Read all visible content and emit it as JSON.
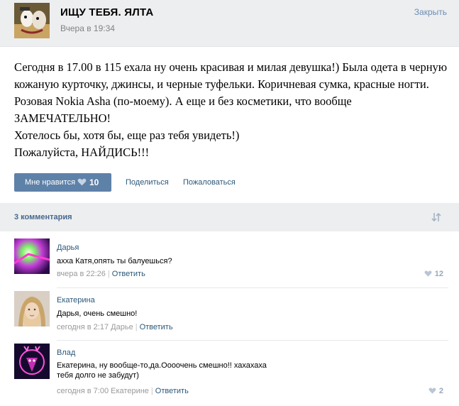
{
  "header": {
    "title": "ИЩУ ТЕБЯ. ЯЛТА",
    "time": "Вчера в 19:34",
    "close_label": "Закрыть",
    "avatar_icon": "cartoon-avatar-icon"
  },
  "post": {
    "text": "Сегодня в 17.00 в 115 ехала ну очень красивая и милая девушка!) Была одета в черную кожаную курточку, джинсы, и черные туфельки. Коричневая сумка, красные ногти. Розовая Nokia Asha (по-моему). А еще и без косметики, что вообще ЗАМЕЧАТЕЛЬНО!\nХотелось бы, хотя бы, еще раз тебя увидеть!)\nПожалуйста, НАЙДИСЬ!!!"
  },
  "actions": {
    "like_label": "Мне нравится",
    "like_count": "10",
    "share_label": "Поделиться",
    "report_label": "Пожаловаться"
  },
  "comments": {
    "count_label": "3 комментария",
    "items": [
      {
        "author": "Дарья",
        "text": "ахха Катя,опять ты балуешься?",
        "time": "вчера в 22:26",
        "reply_to": "",
        "reply_label": "Ответить",
        "likes": "12"
      },
      {
        "author": "Екатерина",
        "text": "Дарья, очень смешно!",
        "time": "сегодня в 2:17",
        "reply_to": "Дарье",
        "reply_label": "Ответить",
        "likes": ""
      },
      {
        "author": "Влад",
        "text": "Екатерина, ну вообще-то,да.Оооочень смешно!! хахахаха\nтебя долго не забудут)",
        "time": "сегодня в 7:00",
        "reply_to": "Екатерине",
        "reply_label": "Ответить",
        "likes": "2"
      }
    ]
  },
  "colors": {
    "accent": "#5e81a8",
    "link": "#2b587a",
    "header_bg": "#edeef0"
  }
}
